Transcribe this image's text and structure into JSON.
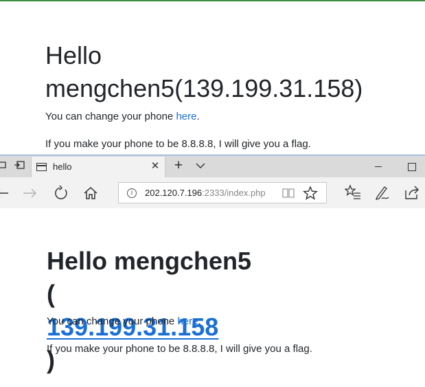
{
  "top_page": {
    "heading_line1": "Hello",
    "heading_line2": "mengchen5(139.199.31.158)",
    "change_phone_prefix": "You can change your phone ",
    "change_phone_link": "here",
    "change_phone_suffix": ".",
    "flag_text": "If you make your phone to be 8.8.8.8, I will give you a flag."
  },
  "browser": {
    "tab_title": "hello",
    "url_host": "202.120.7.196",
    "url_rest": ":2333/index.php",
    "accent_color": "#1a6fd6"
  },
  "bottom_page": {
    "heading_line1": "Hello mengchen5",
    "heading_open_paren": "(",
    "heading_ip": "139.199.31.158",
    "heading_close_paren": ")",
    "change_phone_prefix": "You can change your phone ",
    "change_phone_link": "here",
    "change_phone_suffix": ".",
    "flag_text": "If you make your phone to be 8.8.8.8, I will give you a flag."
  }
}
